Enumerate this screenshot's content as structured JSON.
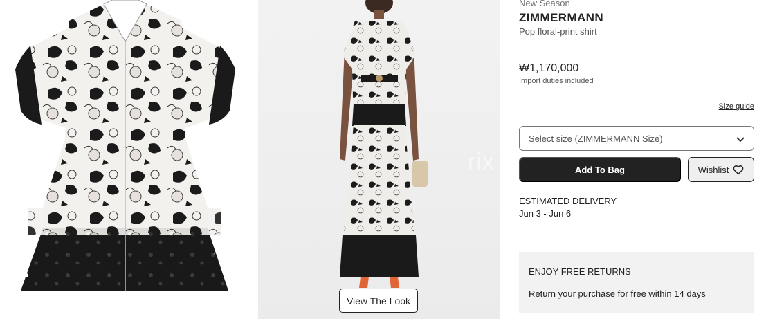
{
  "product_images": {
    "main_image": {
      "alt": "Pop floral-print shirt front view",
      "icon": "shirt-photo"
    },
    "model_image": {
      "alt": "Model wearing look",
      "icon": "model-photo"
    },
    "view_look_label": "View The Look",
    "watermark": "rix"
  },
  "product": {
    "season_tag": "New Season",
    "brand": "ZIMMERMANN",
    "name": "Pop floral-print shirt",
    "price": "₩1,170,000",
    "duties_note": "Import duties included"
  },
  "size": {
    "guide_label": "Size guide",
    "select_placeholder": "Select size (ZIMMERMANN Size)"
  },
  "actions": {
    "add_to_bag": "Add To Bag",
    "wishlist": "Wishlist"
  },
  "delivery": {
    "heading": "ESTIMATED DELIVERY",
    "dates": "Jun 3 - Jun 6"
  },
  "returns": {
    "title": "ENJOY FREE RETURNS",
    "text": "Return your purchase for free within 14 days"
  },
  "colors": {
    "primary_button": "#222222",
    "returns_bg": "#f2f2f2",
    "text": "#222222"
  }
}
